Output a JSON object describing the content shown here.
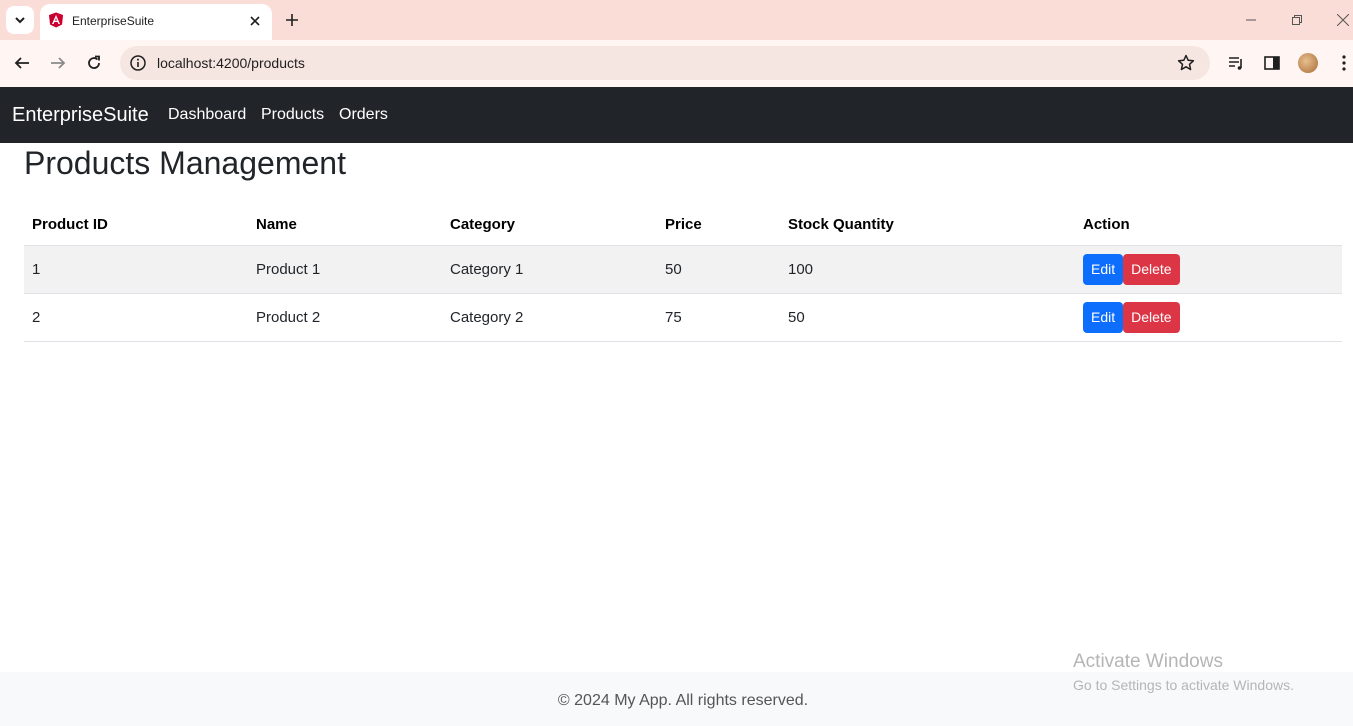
{
  "browser": {
    "tab_title": "EnterpriseSuite",
    "url": "localhost:4200/products"
  },
  "navbar": {
    "brand": "EnterpriseSuite",
    "links": [
      "Dashboard",
      "Products",
      "Orders"
    ]
  },
  "page": {
    "title": "Products Management"
  },
  "table": {
    "headers": [
      "Product ID",
      "Name",
      "Category",
      "Price",
      "Stock Quantity",
      "Action"
    ],
    "rows": [
      {
        "id": "1",
        "name": "Product 1",
        "category": "Category 1",
        "price": "50",
        "stock": "100"
      },
      {
        "id": "2",
        "name": "Product 2",
        "category": "Category 2",
        "price": "75",
        "stock": "50"
      }
    ],
    "edit_label": "Edit",
    "delete_label": "Delete"
  },
  "footer": {
    "text": "© 2024 My App. All rights reserved."
  },
  "watermark": {
    "title": "Activate Windows",
    "subtitle": "Go to Settings to activate Windows."
  },
  "colors": {
    "navbar_bg": "#212529",
    "edit_button": "#0d6efd",
    "delete_button": "#dc3545"
  }
}
